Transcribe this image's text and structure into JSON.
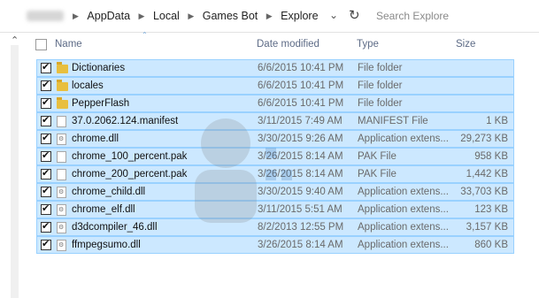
{
  "address_bar": {
    "breadcrumbs": [
      "AppData",
      "Local",
      "Games Bot",
      "Explore"
    ],
    "search_placeholder": "Search Explore"
  },
  "columns": {
    "name": "Name",
    "date": "Date modified",
    "type": "Type",
    "size": "Size"
  },
  "files": [
    {
      "name": "Dictionaries",
      "date": "6/6/2015 10:41 PM",
      "type": "File folder",
      "size": "",
      "icon": "folder-icon"
    },
    {
      "name": "locales",
      "date": "6/6/2015 10:41 PM",
      "type": "File folder",
      "size": "",
      "icon": "folder-icon"
    },
    {
      "name": "PepperFlash",
      "date": "6/6/2015 10:41 PM",
      "type": "File folder",
      "size": "",
      "icon": "folder-icon"
    },
    {
      "name": "37.0.2062.124.manifest",
      "date": "3/11/2015 7:49 AM",
      "type": "MANIFEST File",
      "size": "1 KB",
      "icon": "file-icon"
    },
    {
      "name": "chrome.dll",
      "date": "3/30/2015 9:26 AM",
      "type": "Application extens...",
      "size": "29,273 KB",
      "icon": "dll-icon"
    },
    {
      "name": "chrome_100_percent.pak",
      "date": "3/26/2015 8:14 AM",
      "type": "PAK File",
      "size": "958 KB",
      "icon": "file-icon"
    },
    {
      "name": "chrome_200_percent.pak",
      "date": "3/26/2015 8:14 AM",
      "type": "PAK File",
      "size": "1,442 KB",
      "icon": "file-icon"
    },
    {
      "name": "chrome_child.dll",
      "date": "3/30/2015 9:40 AM",
      "type": "Application extens...",
      "size": "33,703 KB",
      "icon": "dll-icon"
    },
    {
      "name": "chrome_elf.dll",
      "date": "3/11/2015 5:51 AM",
      "type": "Application extens...",
      "size": "123 KB",
      "icon": "dll-icon"
    },
    {
      "name": "d3dcompiler_46.dll",
      "date": "8/2/2013 12:55 PM",
      "type": "Application extens...",
      "size": "3,157 KB",
      "icon": "dll-icon"
    },
    {
      "name": "ffmpegsumo.dll",
      "date": "3/26/2015 8:14 AM",
      "type": "Application extens...",
      "size": "860 KB",
      "icon": "dll-icon"
    }
  ],
  "colors": {
    "selection_bg": "#cce8ff",
    "selection_border": "#99d1ff",
    "header_text": "#5d6b86"
  }
}
